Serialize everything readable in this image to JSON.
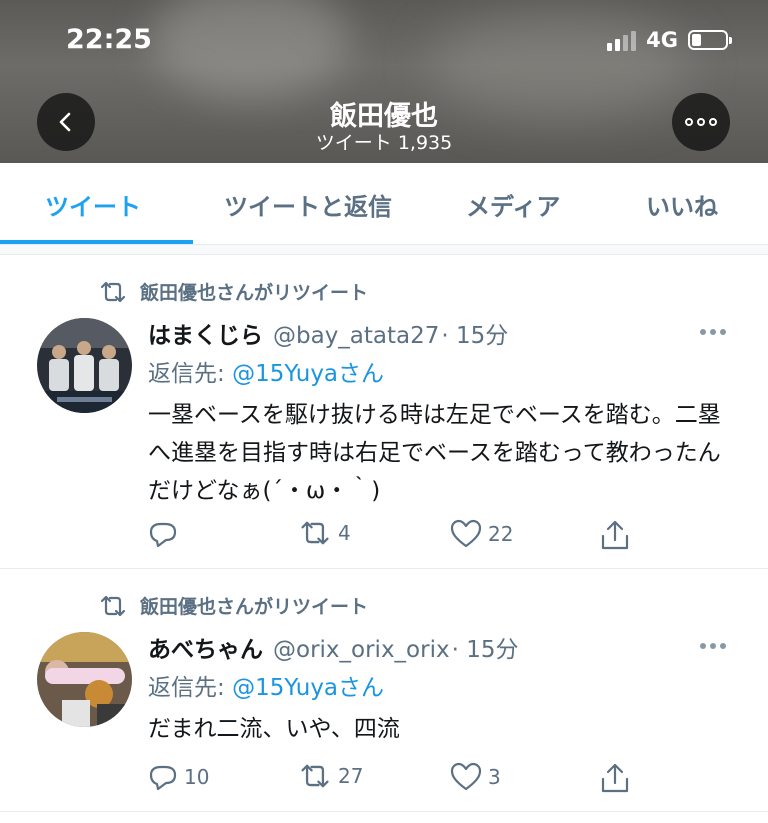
{
  "status": {
    "time": "22:25",
    "network": "4G"
  },
  "header": {
    "title": "飯田優也",
    "subtitle": "ツイート 1,935"
  },
  "tabs": [
    {
      "label": "ツイート",
      "active": true
    },
    {
      "label": "ツイートと返信",
      "active": false
    },
    {
      "label": "メディア",
      "active": false
    },
    {
      "label": "いいね",
      "active": false
    }
  ],
  "tweets": [
    {
      "retweet_label": "飯田優也さんがリツイート",
      "name": "はまくじら",
      "handle": "@bay_atata27",
      "time": "· 15分",
      "reply_prefix": "返信先: ",
      "reply_to": "@15Yuyaさん",
      "text": "一塁ベースを駆け抜ける時は左足でベースを踏む。二塁へ進塁を目指す時は右足でベースを踏むって教わったんだけどなぁ(´・ω・｀)",
      "replies": "",
      "retweets": "4",
      "likes": "22"
    },
    {
      "retweet_label": "飯田優也さんがリツイート",
      "name": "あべちゃん",
      "handle": "@orix_orix_orix",
      "time": "· 15分",
      "reply_prefix": "返信先: ",
      "reply_to": "@15Yuyaさん",
      "text": "だまれ二流、いや、四流",
      "replies": "10",
      "retweets": "27",
      "likes": "3"
    }
  ],
  "colors": {
    "accent": "#1da1f2",
    "secondary_text": "#5b7083",
    "primary_text": "#14171a"
  },
  "icons": [
    "back-arrow-icon",
    "more-icon",
    "retweet-icon",
    "reply-icon",
    "like-icon",
    "share-icon",
    "caret-icon"
  ]
}
